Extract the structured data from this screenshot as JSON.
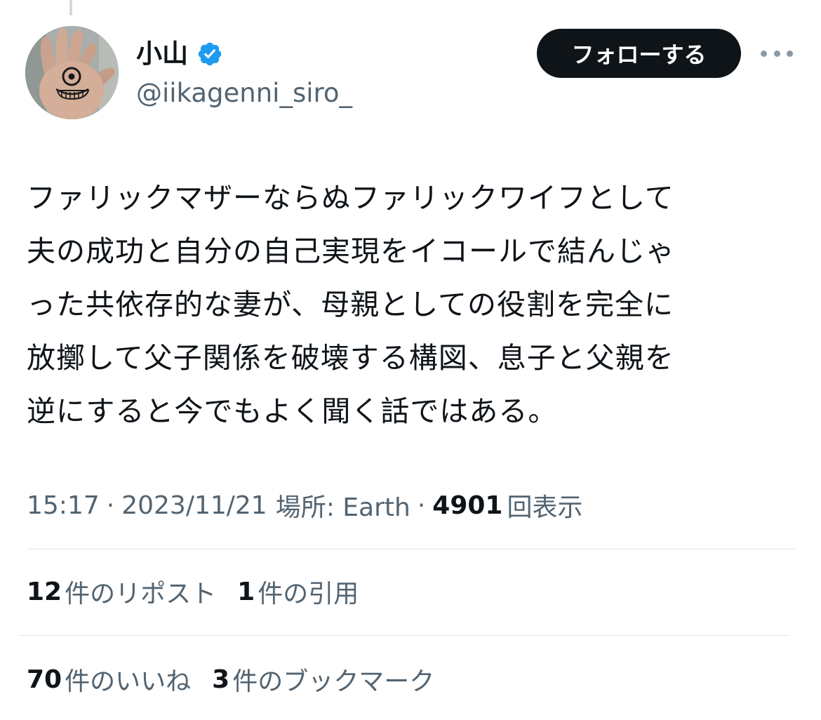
{
  "user": {
    "display_name": "小山",
    "handle": "@iikagenni_siro_",
    "verified_icon": "verified-badge-icon",
    "avatar_icon": "hand-drawn-eye-face-avatar"
  },
  "actions": {
    "follow_label": "フォローする",
    "more_icon": "more-options-icon"
  },
  "tweet": {
    "lines": [
      "ファリックマザーならぬファリックワイフとして",
      "夫の成功と自分の自己実現をイコールで結んじゃ",
      "った共依存的な妻が、母親としての役割を完全に",
      "放擲して父子関係を破壊する構図、息子と父親を",
      "逆にすると今でもよく聞く話ではある。"
    ]
  },
  "meta": {
    "time": "15:17",
    "separator": "·",
    "date": "2023/11/21",
    "location": "場所: Earth",
    "views_count": "4901",
    "views_label": "回表示"
  },
  "stats": {
    "reposts": {
      "count": "12",
      "label": "件のリポスト"
    },
    "quotes": {
      "count": "1",
      "label": "件の引用"
    },
    "likes": {
      "count": "70",
      "label": "件のいいね"
    },
    "bookmarks": {
      "count": "3",
      "label": "件のブックマーク"
    }
  },
  "colors": {
    "text_primary": "#0f1419",
    "text_secondary": "#536471",
    "verified_blue": "#1d9bf0",
    "divider": "#e3e7ea"
  }
}
